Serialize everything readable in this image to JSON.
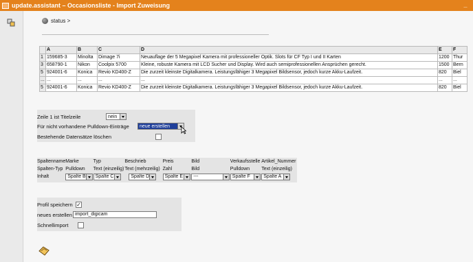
{
  "window": {
    "title": "update.assistant – Occasionsliste - Import Zuweisung",
    "minimize": "_"
  },
  "status": {
    "label": "status >"
  },
  "grid": {
    "headers": [
      "",
      "A",
      "B",
      "C",
      "D",
      "E",
      "F"
    ],
    "rows": [
      [
        "1",
        "159685-3",
        "Minolta",
        "Dimage 7i",
        "Neuauflage der 5 Megapixel Kamera mit professioneller Optik. Slots für CF Typ I und II Karten",
        "1200",
        "Thur"
      ],
      [
        "3",
        "658790-1",
        "Nikon",
        "Coolpix 5700",
        "Kleine, robuste Kamera mit LCD Sucher und Display. Wird auch semiprofessionellen Ansprüchen gerecht.",
        "1500",
        "Bern"
      ],
      [
        "5",
        "924001-6",
        "Konica",
        "Revio KD400-Z",
        "Die zurzeit kleinste Digitalkamera. Leistungsfähiger 3 Megapixel Bildsensor, jedoch kurze Akku-Laufzeit.",
        "820",
        "Biel"
      ],
      [
        "...",
        "...",
        "...",
        "...",
        "...",
        "...",
        "..."
      ],
      [
        "5",
        "924001-6",
        "Konica",
        "Revio KD400-Z",
        "Die zurzeit kleinste Digitalkamera. Leistungsfähiger 3 Megapixel Bildsensor, jedoch kurze Akku-Laufzeit.",
        "820",
        "Biel"
      ]
    ]
  },
  "options": {
    "titlerow_label": "Zeile 1 ist Titelzeile",
    "titlerow_value": "nein",
    "pulldown_label": "Für nicht vorhandene Pulldown-Einträge",
    "pulldown_value": "neue erstellen",
    "delete_label": "Bestehende Datensätze löschen"
  },
  "mapping": {
    "names": [
      "Spaltenname",
      "Marke",
      "Typ",
      "Beschrieb",
      "Preis",
      "Bild",
      "Verkaufsstelle",
      "Artikel_Nummer"
    ],
    "types": [
      "Spalten-Typ",
      "Pulldown",
      "Text (einzeilig)",
      "Text (mehrzeilig)",
      "Zahl",
      "Bild",
      "Pulldown",
      "Text (einzeilig)"
    ],
    "content_label": "Inhalt",
    "selects": [
      "Spalte B",
      "Spalte C",
      "Spalte D",
      "Spalte E",
      "---",
      "Spalte F",
      "Spalte A"
    ]
  },
  "profile": {
    "save_label": "Profil speichern",
    "save_checked": "✓",
    "new_label": "neues erstellen",
    "new_value": "import_digicam",
    "quick_label": "Schnellimport"
  },
  "colors": {
    "titlebar": "#e4821c",
    "selected": "#1f3f9a"
  },
  "icons": {
    "app": "window-icon",
    "tool": "wizard-icon",
    "status": "status-dot-icon",
    "save": "save-disk-icon"
  }
}
